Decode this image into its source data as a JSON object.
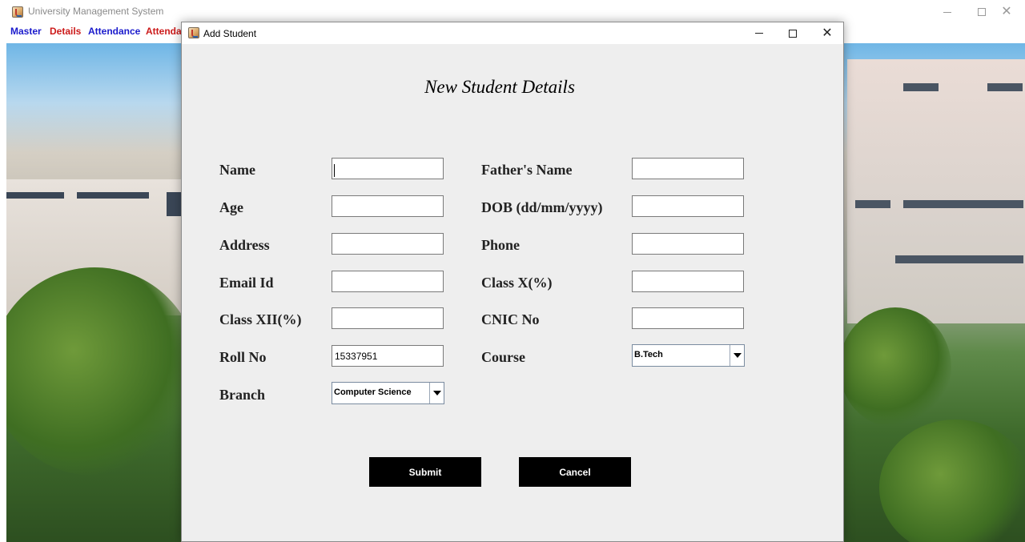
{
  "main_window": {
    "title": "University Management System",
    "controls": {
      "minimize": "—",
      "maximize": "☐",
      "close": "✕"
    }
  },
  "menu": [
    {
      "label": "Master",
      "color": "#1a1acc"
    },
    {
      "label": "Details",
      "color": "#cc1a1a"
    },
    {
      "label": "Attendance",
      "color": "#1a1acc"
    },
    {
      "label": "Attendance",
      "color": "#cc1a1a"
    }
  ],
  "dialog": {
    "title": "Add Student",
    "controls": {
      "minimize": "—",
      "maximize": "☐",
      "close": "✕"
    },
    "heading": "New Student Details",
    "left_fields": [
      {
        "label": "Name",
        "value": ""
      },
      {
        "label": "Age",
        "value": ""
      },
      {
        "label": "Address",
        "value": ""
      },
      {
        "label": "Email Id",
        "value": ""
      },
      {
        "label": "Class XII(%)",
        "value": ""
      },
      {
        "label": "Roll No",
        "value": "15337951"
      }
    ],
    "right_fields": [
      {
        "label": "Father's Name",
        "value": ""
      },
      {
        "label": "DOB (dd/mm/yyyy)",
        "value": ""
      },
      {
        "label": "Phone",
        "value": ""
      },
      {
        "label": "Class X(%)",
        "value": ""
      },
      {
        "label": "CNIC No",
        "value": ""
      }
    ],
    "course": {
      "label": "Course",
      "selected": "B.Tech"
    },
    "branch": {
      "label": "Branch",
      "selected": "Computer Science"
    },
    "buttons": {
      "submit": "Submit",
      "cancel": "Cancel"
    }
  },
  "colors": {
    "dialog_bg": "#eeeeee",
    "button_bg": "#000000",
    "button_text": "#ffffff"
  },
  "icons": {
    "app": "java-coffee-cup-icon",
    "dropdown": "triangle-down-icon"
  }
}
